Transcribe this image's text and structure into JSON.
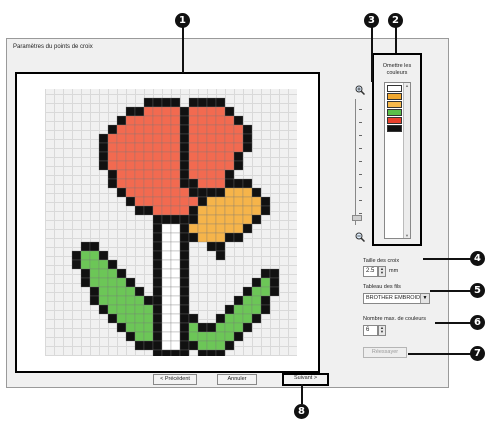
{
  "dialog": {
    "title": "Paramètres du points de croix"
  },
  "callouts": {
    "preview": "1",
    "color_list": "2",
    "zoom_slider": "3",
    "cross_size": "4",
    "thread_table": "5",
    "max_colors": "6",
    "refresh": "7",
    "next": "8"
  },
  "colors_panel": {
    "title": "Omettre les couleurs",
    "swatches": [
      "#ffffff",
      "#f0a830",
      "#f6b84a",
      "#5bbf4a",
      "#e8402c",
      "#111111"
    ]
  },
  "cross_size": {
    "label": "Taille des croix",
    "value": "2.5",
    "unit": "mm"
  },
  "thread_table": {
    "label": "Tableau des fils",
    "selected": "BROTHER EMBROIDERY"
  },
  "max_colors": {
    "label": "Nombre max. de couleurs",
    "value": "6"
  },
  "buttons": {
    "refresh": "Réessayer",
    "back": "< Précédent",
    "cancel": "Annuler",
    "next": "Suivant >"
  },
  "icons": {
    "zoom_in": "zoom-in-icon",
    "zoom_out": "zoom-out-icon"
  }
}
